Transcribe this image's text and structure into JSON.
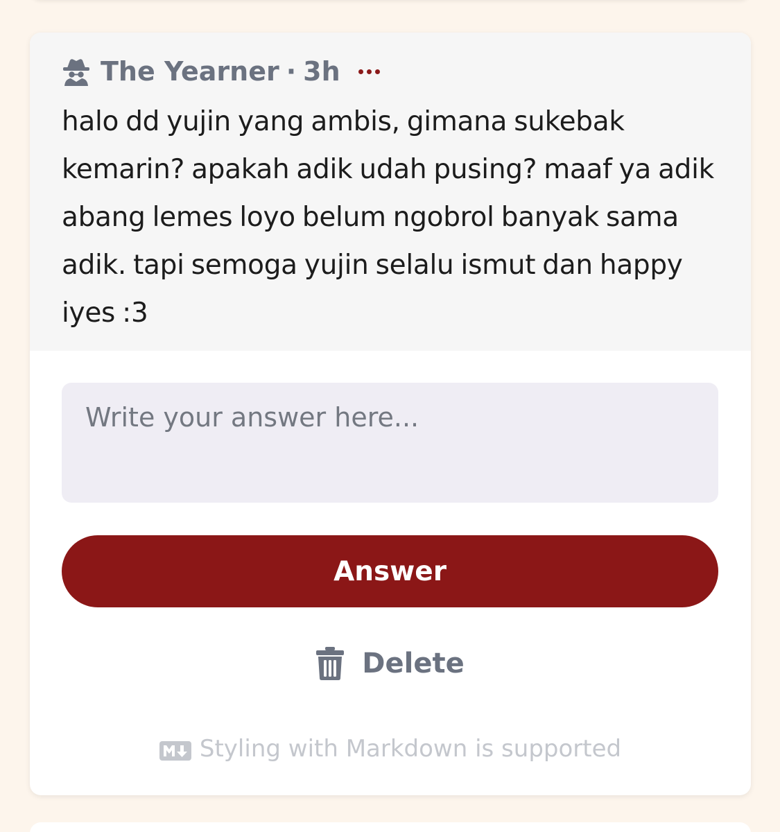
{
  "question": {
    "author": "The Yearner",
    "separator": "·",
    "time": "3h",
    "author_icon": "detective-icon",
    "text": "halo dd yujin yang ambis, gimana sukebak kemarin? apakah adik udah pusing? maaf ya adik abang lemes loyo belum ngobrol banyak sama adik. tapi semoga yujin selalu ismut dan happy iyes :3"
  },
  "answer": {
    "placeholder": "Write your answer here...",
    "value": "",
    "submit_label": "Answer",
    "delete_label": "Delete",
    "markdown_note": "Styling with Markdown is supported",
    "markdown_icon": "markdown-icon",
    "delete_icon": "trash-icon"
  },
  "colors": {
    "accent": "#8b1717",
    "page_background": "#fdf5ec",
    "question_background": "#f6f6f6",
    "input_background": "#efedf4",
    "muted_text": "#6b7280"
  }
}
